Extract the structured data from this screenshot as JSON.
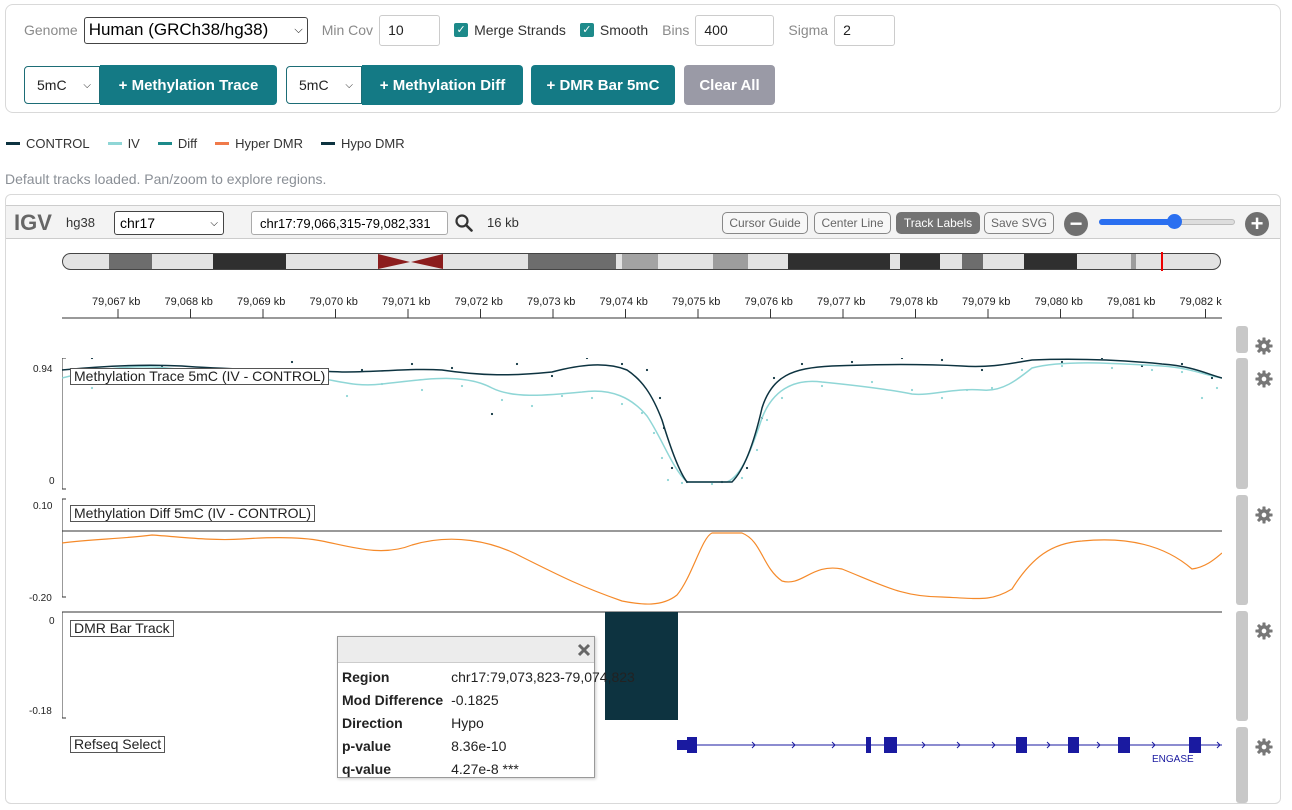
{
  "controls": {
    "genome_label": "Genome",
    "genome_value": "Human (GRCh38/hg38)",
    "mincov_label": "Min Cov",
    "mincov_value": "10",
    "merge_label": "Merge Strands",
    "smooth_label": "Smooth",
    "bins_label": "Bins",
    "bins_value": "400",
    "sigma_label": "Sigma",
    "sigma_value": "2",
    "trace_mod": "5mC",
    "trace_btn": "+ Methylation Trace",
    "diff_mod": "5mC",
    "diff_btn": "+ Methylation Diff",
    "dmr_btn": "+ DMR Bar 5mC",
    "clear_btn": "Clear All"
  },
  "legend": [
    {
      "label": "CONTROL",
      "color": "#0d3340"
    },
    {
      "label": "IV",
      "color": "#8fd6d6"
    },
    {
      "label": "Diff",
      "color": "#1d8a8a"
    },
    {
      "label": "Hyper DMR",
      "color": "#f07a4a"
    },
    {
      "label": "Hypo DMR",
      "color": "#0d3340"
    }
  ],
  "status": "Default tracks loaded. Pan/zoom to explore regions.",
  "igv": {
    "logo": "IGV",
    "genome": "hg38",
    "chromosome": "chr17",
    "locus": "chr17:79,066,315-79,082,331",
    "width": "16 kb",
    "buttons": {
      "cursor_guide": "Cursor Guide",
      "center_line": "Center Line",
      "track_labels": "Track Labels",
      "save_svg": "Save SVG"
    },
    "zoom_minus": "−",
    "zoom_plus": "+",
    "zoom_level": 0.55,
    "ruler_ticks": [
      "79,067 kb",
      "79,068 kb",
      "79,069 kb",
      "79,070 kb",
      "79,071 kb",
      "79,072 kb",
      "79,073 kb",
      "79,074 kb",
      "79,075 kb",
      "79,076 kb",
      "79,077 kb",
      "79,078 kb",
      "79,079 kb",
      "79,080 kb",
      "79,081 kb",
      "79,082 kb"
    ]
  },
  "tracks": {
    "trace": {
      "label": "Methylation Trace 5mC (IV - CONTROL)",
      "ymax": "0.94",
      "ymin": "0"
    },
    "diff": {
      "label": "Methylation Diff 5mC (IV - CONTROL)",
      "ymax": "0.10",
      "ymin": "-0.20"
    },
    "dmr": {
      "label": "DMR Bar Track",
      "ymax": "0",
      "ymin": "-0.18"
    },
    "refseq": {
      "label": "Refseq Select",
      "gene": "ENGASE"
    }
  },
  "popup": {
    "rows": [
      {
        "key": "Region",
        "value": "chr17:79,073,823-79,074,823"
      },
      {
        "key": "Mod Difference",
        "value": "-0.1825"
      },
      {
        "key": "Direction",
        "value": "Hypo"
      },
      {
        "key": "p-value",
        "value": "8.36e-10"
      },
      {
        "key": "q-value",
        "value": "4.27e-8 ***"
      }
    ]
  }
}
